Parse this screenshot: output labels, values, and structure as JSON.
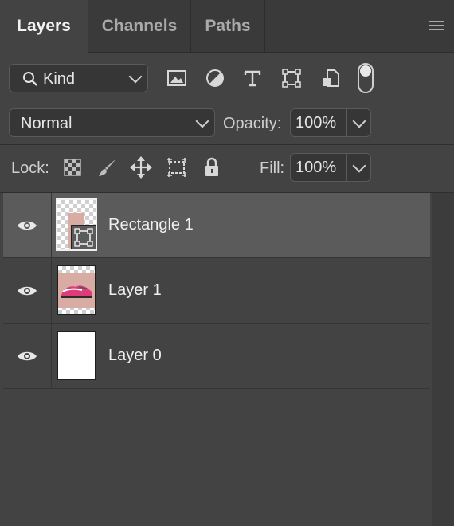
{
  "tabs": [
    {
      "label": "Layers",
      "active": true
    },
    {
      "label": "Channels",
      "active": false
    },
    {
      "label": "Paths",
      "active": false
    }
  ],
  "filter": {
    "kind_label": "Kind"
  },
  "filter_icons": [
    "image-filter-icon",
    "adjustment-filter-icon",
    "type-filter-icon",
    "shape-filter-icon",
    "smart-object-filter-icon",
    "filter-toggle-icon"
  ],
  "blend": {
    "mode": "Normal",
    "opacity_label": "Opacity:",
    "opacity_value": "100%"
  },
  "lock": {
    "label": "Lock:",
    "fill_label": "Fill:",
    "fill_value": "100%"
  },
  "layers": [
    {
      "name": "Rectangle 1",
      "selected": true,
      "visible": true
    },
    {
      "name": "Layer 1",
      "selected": false,
      "visible": true
    },
    {
      "name": "Layer 0",
      "selected": false,
      "visible": true
    }
  ],
  "colors": {
    "panel": "#434343",
    "selected_layer": "#5b5b5b",
    "thumb_pink": "#d8aca3"
  }
}
